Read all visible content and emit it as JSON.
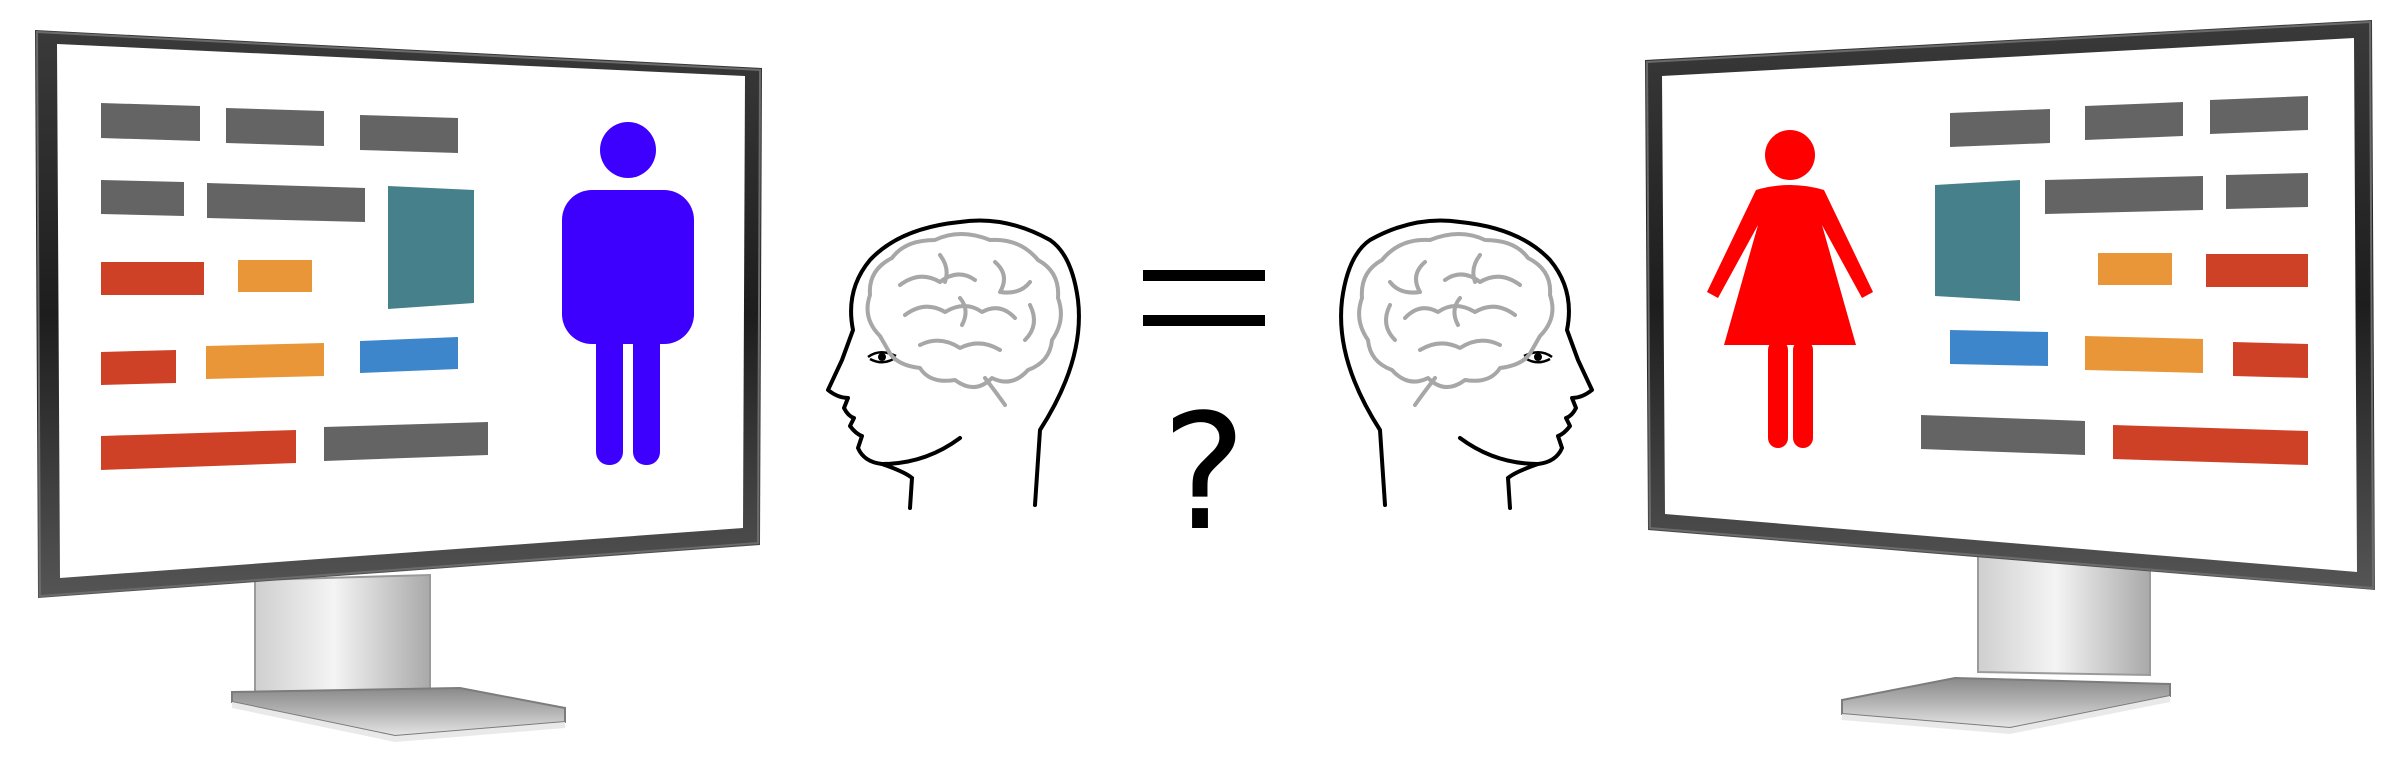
{
  "diagram": {
    "operator": {
      "equals": "=",
      "question": "?"
    },
    "colors": {
      "male_figure": "#3d00ff",
      "female_figure": "#ff0000",
      "bar_gray": "#646464",
      "bar_red": "#cf4127",
      "bar_orange": "#e89638",
      "bar_blue": "#3d86cb",
      "panel_teal": "#45808b",
      "brain_gray": "#a7a7a7",
      "outline": "#000000"
    },
    "left_monitor": {
      "figure": "male-figure-icon",
      "tone": "left"
    },
    "right_monitor": {
      "figure": "female-figure-icon",
      "tone": "right"
    },
    "left_head": {
      "facing": "left",
      "icon": "head-with-brain-icon"
    },
    "right_head": {
      "facing": "right",
      "icon": "head-with-brain-icon"
    }
  }
}
